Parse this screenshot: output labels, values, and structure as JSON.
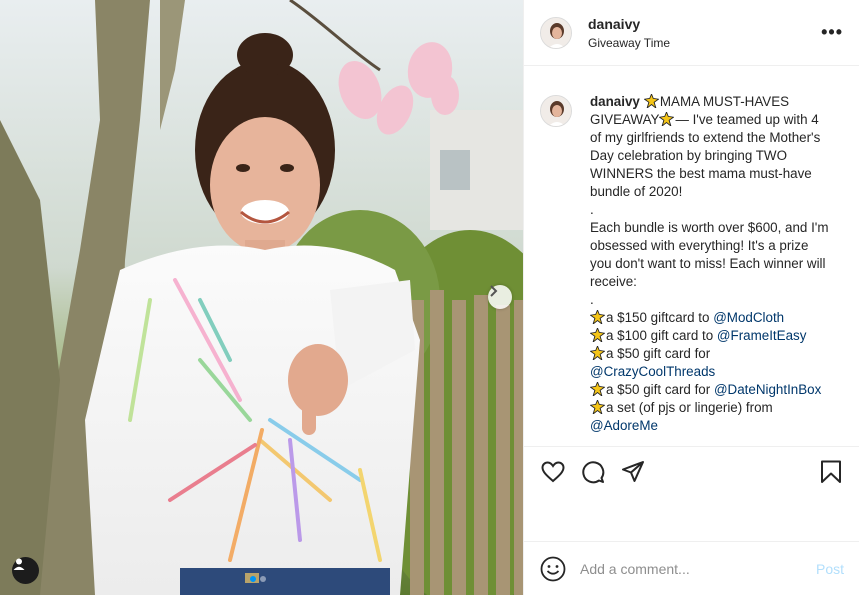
{
  "post": {
    "image_alt": "Woman in tie-dye sweatshirt pointing at camera",
    "carousel": {
      "total": 2,
      "current": 1
    }
  },
  "header": {
    "username": "danaivy",
    "location": "Giveaway Time",
    "more_icon": "more-dots-icon"
  },
  "caption": {
    "username": "danaivy",
    "line_intro": "MAMA MUST-HAVES GIVEAWAY",
    "line_intro_rest": "— I've teamed up with 4 of my girlfriends to extend the Mother's Day celebration by bringing TWO WINNERS the best mama must-have bundle of 2020!",
    "dot1": ".",
    "paragraph2": "Each bundle is worth over $600, and I'm obsessed with everything! It's a prize you don't want to miss! Each winner will receive:",
    "dot2": ".",
    "prizes": [
      {
        "text": "a $150 giftcard to ",
        "mention": "@ModCloth"
      },
      {
        "text": "a $100 gift card to ",
        "mention": "@FrameItEasy"
      },
      {
        "text": "a $50 gift card for ",
        "mention": "@CrazyCoolThreads"
      },
      {
        "text": "a $50 gift card for ",
        "mention": "@DateNightInBox"
      },
      {
        "text": "a set (of pjs or lingerie) from ",
        "mention": "@AdoreMe"
      }
    ]
  },
  "actions": {
    "like_icon": "heart-icon",
    "comment_icon": "comment-icon",
    "share_icon": "paper-plane-icon",
    "save_icon": "bookmark-icon"
  },
  "comment_box": {
    "placeholder": "Add a comment...",
    "post_label": "Post",
    "emoji_icon": "smiley-icon"
  },
  "colors": {
    "accent": "#0095f6",
    "mention": "#00376b",
    "post_disabled": "#b2dffc",
    "border": "#efefef"
  }
}
